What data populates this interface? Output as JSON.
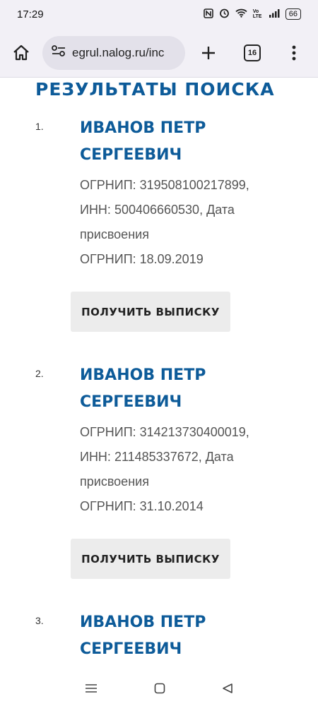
{
  "status": {
    "time": "17:29",
    "battery": "66",
    "network": "Vo LTE"
  },
  "browser": {
    "url": "egrul.nalog.ru/inc",
    "tab_count": "16"
  },
  "page": {
    "title": "РЕЗУЛЬТАТЫ ПОИСКА",
    "results": [
      {
        "number": "1.",
        "name": "ИВАНОВ ПЕТР СЕРГЕЕВИЧ",
        "line1": "ОГРНИП: 319508100217899,",
        "line2": "ИНН: 500406660530, Дата",
        "line3": "присвоения",
        "line4": "ОГРНИП: 18.09.2019",
        "button": "ПОЛУЧИТЬ ВЫПИСКУ"
      },
      {
        "number": "2.",
        "name": "ИВАНОВ ПЕТР СЕРГЕЕВИЧ",
        "line1": "ОГРНИП: 314213730400019,",
        "line2": "ИНН: 211485337672, Дата",
        "line3": "присвоения",
        "line4": "ОГРНИП: 31.10.2014",
        "button": "ПОЛУЧИТЬ ВЫПИСКУ"
      },
      {
        "number": "3.",
        "name": "ИВАНОВ ПЕТР СЕРГЕЕВИЧ"
      }
    ]
  }
}
